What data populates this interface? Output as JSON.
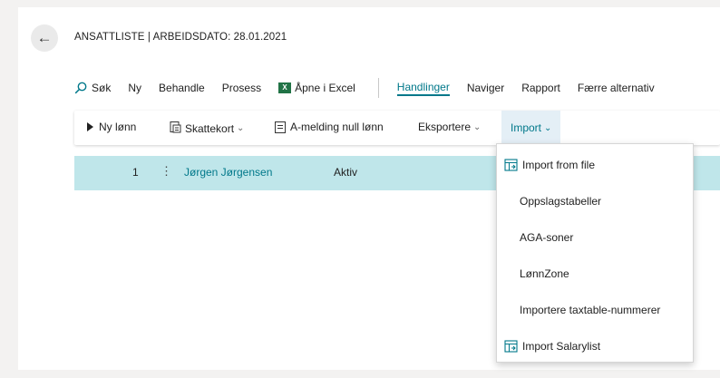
{
  "page": {
    "title": "ANSATTLISTE | ARBEIDSDATO: 28.01.2021",
    "back_icon": "arrow-left-icon"
  },
  "action_bar": {
    "search_label": "Søk",
    "new_label": "Ny",
    "process_label": "Behandle",
    "process2_label": "Prosess",
    "excel_label": "Åpne i Excel",
    "actions_label": "Handlinger",
    "navigate_label": "Naviger",
    "report_label": "Rapport",
    "fewer_label": "Færre alternativ"
  },
  "toolbar": {
    "new_salary_label": "Ny lønn",
    "tax_card_label": "Skattekort",
    "amelding_label": "A-melding null lønn",
    "export_label": "Eksportere",
    "import_label": "Import"
  },
  "table": {
    "rows": [
      {
        "number": "1",
        "name": "Jørgen Jørgensen",
        "status": "Aktiv"
      }
    ]
  },
  "import_menu": {
    "items": [
      {
        "label": "Import from file",
        "icon": "import-file-icon"
      },
      {
        "label": "Oppslagstabeller"
      },
      {
        "label": "AGA-soner"
      },
      {
        "label": "LønnZone"
      },
      {
        "label": "Importere taxtable-nummerer"
      },
      {
        "label": "Import Salarylist",
        "icon": "import-file-icon"
      }
    ]
  },
  "colors": {
    "accent": "#00788a",
    "selected_row": "#bfe6ea",
    "open_button_bg": "#e4eff6",
    "excel": "#217346"
  }
}
